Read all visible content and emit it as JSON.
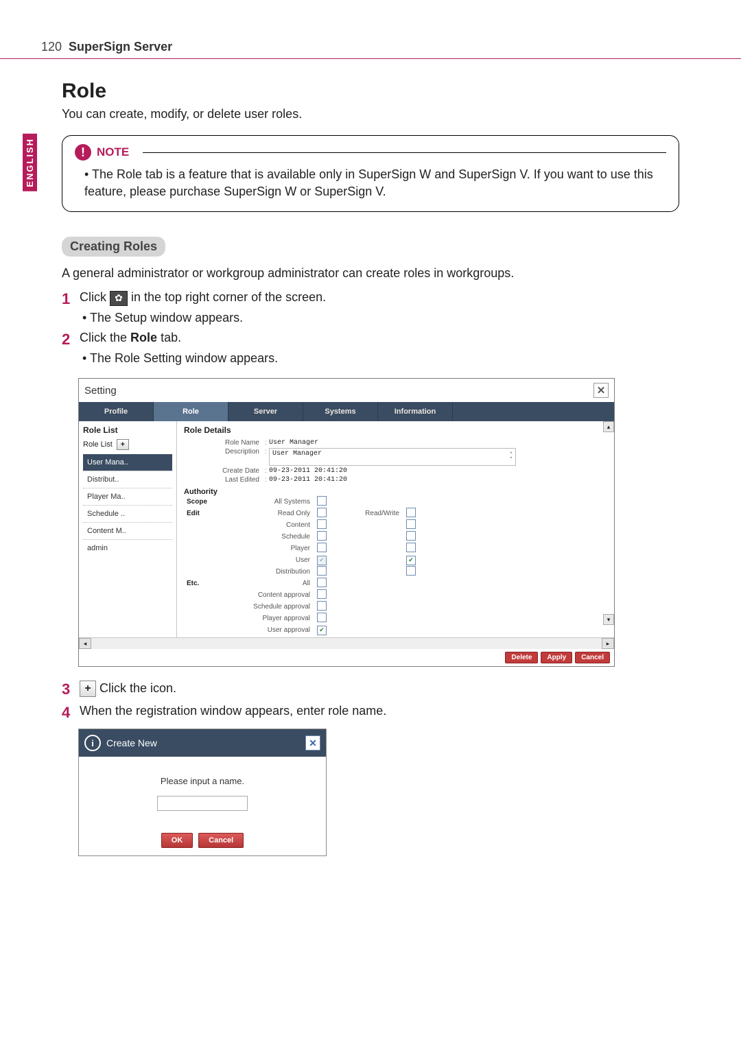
{
  "header": {
    "page": "120",
    "title": "SuperSign Server"
  },
  "lang": "ENGLISH",
  "h1": "Role",
  "intro": "You can create, modify, or delete user roles.",
  "note": {
    "label": "NOTE",
    "body": "The Role tab is a feature that is available only in SuperSign W and SuperSign V. If you want to use this feature, please purchase SuperSign W or SuperSign V."
  },
  "subheading": "Creating Roles",
  "para": "A general administrator or workgroup administrator can create roles in workgroups.",
  "steps": {
    "s1a": "Click ",
    "s1b": " in the top right corner of the screen.",
    "s1sub": "The Setup window appears.",
    "s2a": "Click the ",
    "s2b": "Role",
    "s2c": " tab.",
    "s2sub": "The Role Setting window appears.",
    "s3": "Click the icon.",
    "s4": "When the registration window appears, enter role name."
  },
  "window": {
    "title": "Setting",
    "tabs": [
      "Profile",
      "Role",
      "Server",
      "Systems",
      "Information"
    ],
    "activeTab": 1,
    "roleListTitle": "Role List",
    "roleListLabel": "Role List",
    "roleItems": [
      "User Mana..",
      "Distribut..",
      "Player Ma..",
      "Schedule ..",
      "Content M..",
      "admin"
    ],
    "details": {
      "title": "Role Details",
      "roleNameLabel": "Role Name",
      "roleName": "User Manager",
      "descriptionLabel": "Description",
      "description": "User Manager",
      "createDateLabel": "Create Date",
      "createDate": "09-23-2011 20:41:20",
      "lastEditedLabel": "Last Edited",
      "lastEdited": "09-23-2011 20:41:20"
    },
    "authority": {
      "title": "Authority",
      "scope": "Scope",
      "allSystems": "All Systems",
      "edit": "Edit",
      "readOnly": "Read Only",
      "readWrite": "Read/Write",
      "rows": [
        "Content",
        "Schedule",
        "Player",
        "User",
        "Distribution"
      ],
      "etc": "Etc.",
      "all": "All",
      "etcRows": [
        "Content approval",
        "Schedule approval",
        "Player approval",
        "User approval"
      ]
    },
    "buttons": {
      "delete": "Delete",
      "apply": "Apply",
      "cancel": "Cancel"
    }
  },
  "dialog": {
    "title": "Create New",
    "msg": "Please input a name.",
    "ok": "OK",
    "cancel": "Cancel"
  }
}
